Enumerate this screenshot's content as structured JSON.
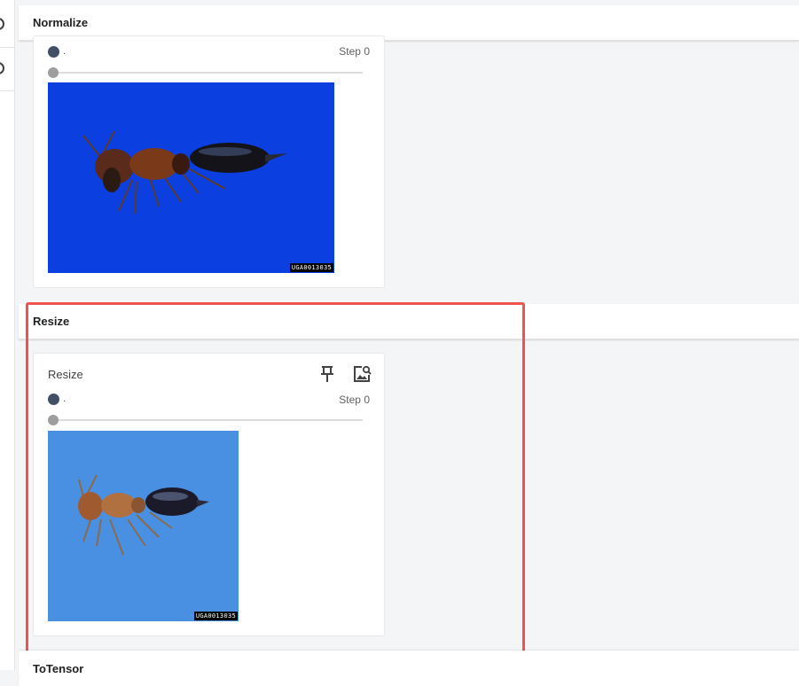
{
  "sections": {
    "normalize": {
      "title": "Normalize"
    },
    "resize": {
      "title": "Resize"
    },
    "to_tensor": {
      "title": "ToTensor"
    }
  },
  "normalize_card": {
    "run_label": ".",
    "step_label": "Step 0",
    "image_stamp": "UGA0013035",
    "image_background": "#0a3ddb"
  },
  "resize_card": {
    "name": "Resize",
    "run_label": ".",
    "step_label": "Step 0",
    "image_stamp": "UGA0013035",
    "image_background": "#4a8fe0",
    "pin_icon": "pin-icon",
    "zoom_image_icon": "image-search-icon"
  },
  "colors": {
    "highlight": "#ef5350",
    "run_dot": "#425066",
    "page_background": "#f4f5f7"
  }
}
